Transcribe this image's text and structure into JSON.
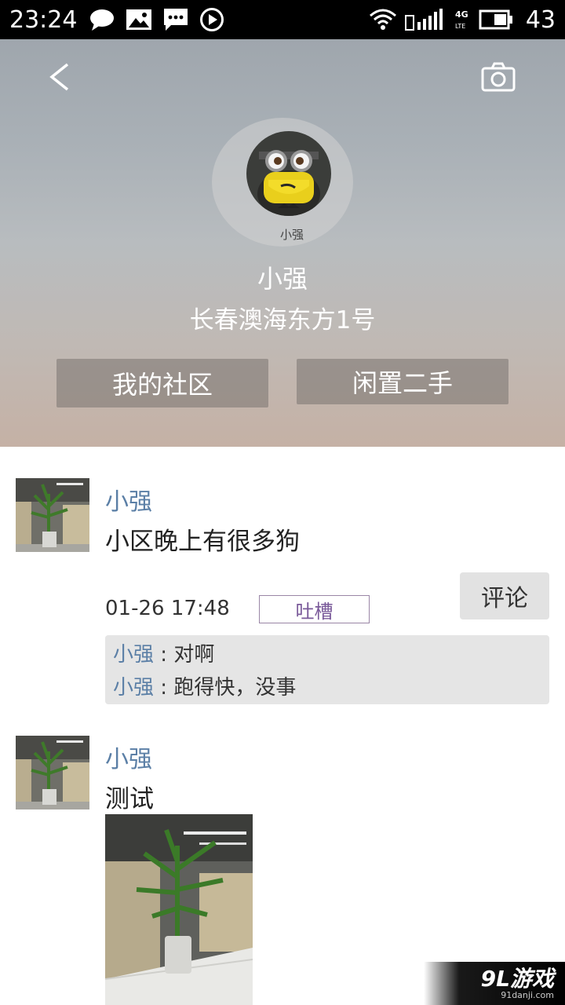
{
  "status_bar": {
    "time": "23:24",
    "network": "4G LTE",
    "battery_level": "43",
    "icons_left": [
      "message-icon",
      "image-icon",
      "sms-icon",
      "play-icon"
    ],
    "icons_right": [
      "wifi-icon",
      "signal-icon",
      "battery-icon"
    ]
  },
  "header": {
    "back_icon": "back-arrow-icon",
    "camera_icon": "camera-icon",
    "avatar_caption": "小强",
    "name": "小强",
    "address": "长春澳海东方1号",
    "buttons": {
      "community": "我的社区",
      "secondhand": "闲置二手"
    }
  },
  "feed": {
    "posts": [
      {
        "author": "小强",
        "text": "小区晚上有很多狗",
        "time": "01-26 17:48",
        "tag": "吐槽",
        "comment_button": "评论",
        "comments": [
          {
            "author": "小强",
            "sep": " : ",
            "text": "对啊"
          },
          {
            "author": "小强",
            "sep": " : ",
            "text": "跑得快，没事"
          }
        ]
      },
      {
        "author": "小强",
        "text": "测试"
      }
    ]
  },
  "watermark": {
    "main": "9L游戏",
    "sub": "91danji.com"
  }
}
